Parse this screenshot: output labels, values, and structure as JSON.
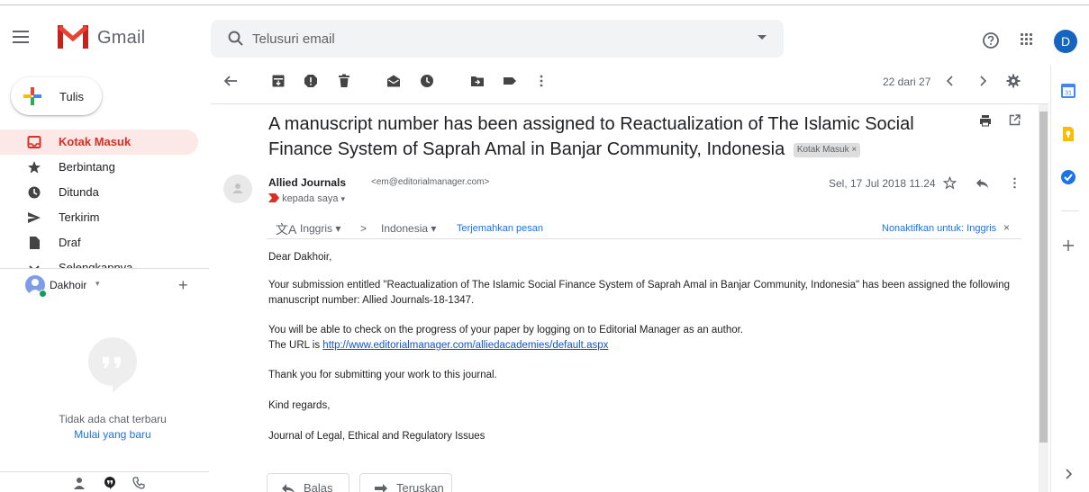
{
  "app": {
    "name": "Gmail",
    "avatar_letter": "D",
    "brand_red": "#EA4335",
    "accent_blue": "#1a73e8"
  },
  "search": {
    "placeholder": "Telusuri email"
  },
  "compose": {
    "label": "Tulis"
  },
  "sidebar": {
    "items": [
      {
        "label": "Kotak Masuk",
        "icon": "inbox-icon",
        "active": true
      },
      {
        "label": "Berbintang",
        "icon": "star-icon"
      },
      {
        "label": "Ditunda",
        "icon": "clock-icon"
      },
      {
        "label": "Terkirim",
        "icon": "send-icon"
      },
      {
        "label": "Draf",
        "icon": "draft-icon"
      },
      {
        "label": "Selengkapnya",
        "icon": "chevron-down-icon"
      }
    ]
  },
  "hangouts": {
    "user": "Dakhoir",
    "empty_text": "Tidak ada chat terbaru",
    "start_link": "Mulai yang baru"
  },
  "toolbar": {
    "count": "22 dari 27"
  },
  "email": {
    "subject": "A manuscript number has been assigned to Reactualization of The Islamic Social Finance System of Saprah Amal in Banjar Community, Indonesia",
    "label_chip": "Kotak Masuk ×",
    "sender_name": "Allied Journals",
    "sender_email": "<em@editorialmanager.com>",
    "to": "kepada saya",
    "date": "Sel, 17 Jul 2018 11.24",
    "translate": {
      "from": "Inggris",
      "to": "Indonesia",
      "translate_link": "Terjemahkan pesan",
      "disable_link": "Nonaktifkan untuk: Inggris"
    },
    "body": {
      "greeting": "Dear  Dakhoir,",
      "p1": "Your submission entitled \"Reactualization of The Islamic Social Finance System of Saprah Amal in Banjar Community, Indonesia\" has been assigned the following manuscript number: Allied Journals-18-1347.",
      "p2_line1": "You will be able to check on the progress of your paper by logging on to Editorial Manager as an author.",
      "p2_prefix": "The URL is ",
      "p2_url": "http://www.editorialmanager.com/alliedacademies/default.aspx",
      "p3": "Thank you for submitting your work to this journal.",
      "p4": "Kind regards,",
      "p5": "Journal of Legal, Ethical and Regulatory Issues"
    },
    "reply_label": "Balas",
    "forward_label": "Teruskan"
  }
}
